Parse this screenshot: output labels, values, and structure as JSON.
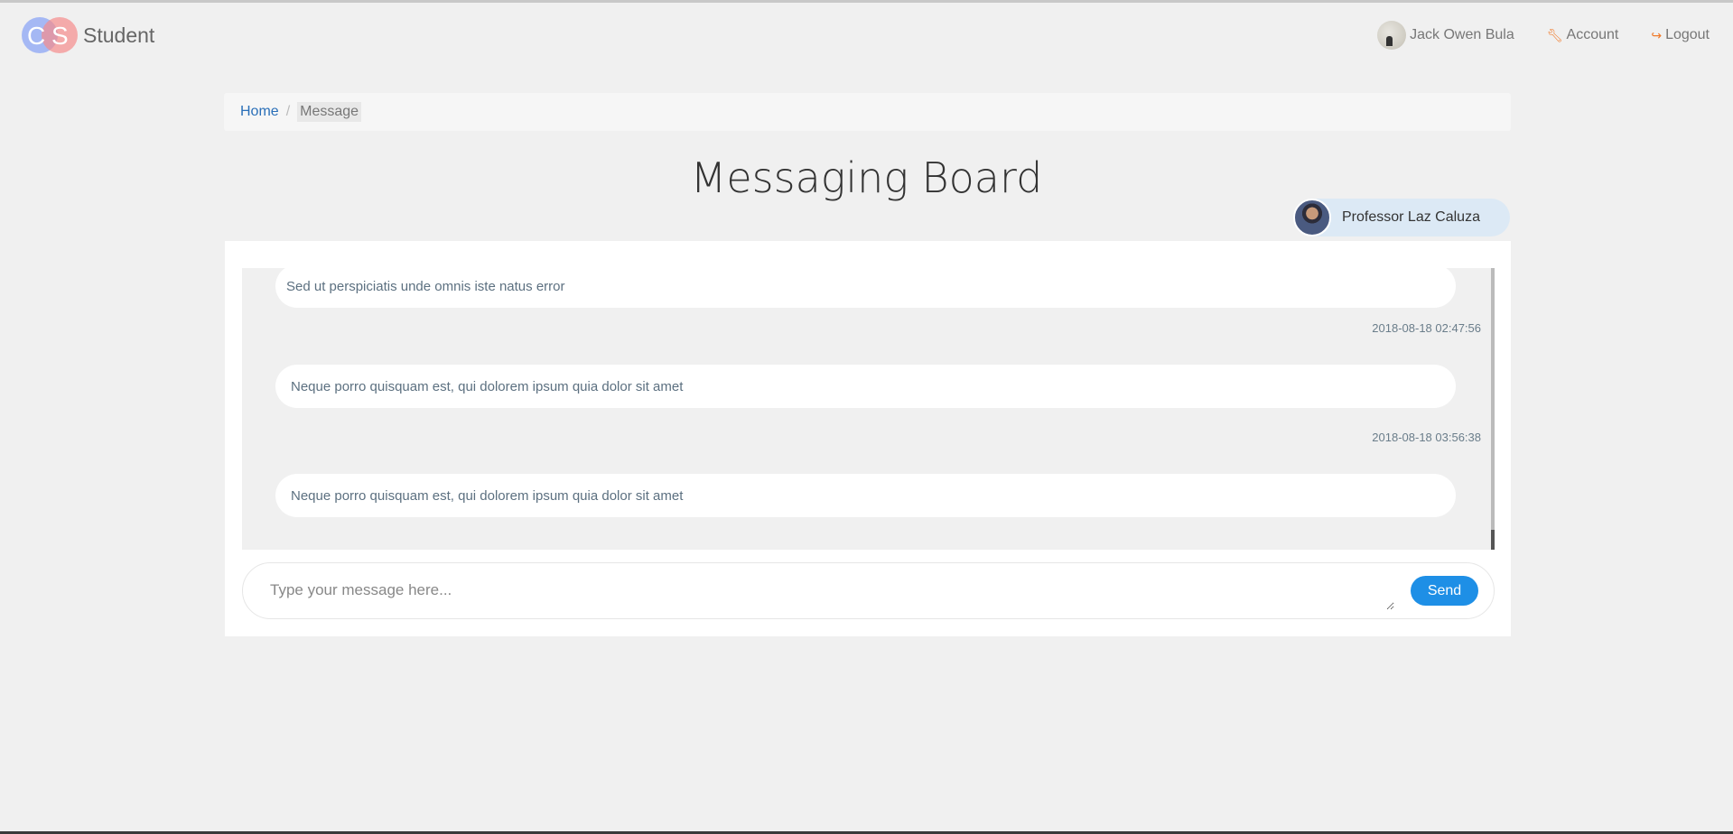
{
  "brand": {
    "name": "Student",
    "logo_letters": [
      "C",
      "S"
    ]
  },
  "nav": {
    "user_name": "Jack Owen Bula",
    "account_label": "Account",
    "logout_label": "Logout",
    "account_icon": "wrench-icon",
    "logout_icon": "sign-out-icon"
  },
  "breadcrumb": {
    "home": "Home",
    "separator": "/",
    "current": "Message"
  },
  "page": {
    "title": "Messaging Board"
  },
  "contact": {
    "name": "Professor Laz Caluza"
  },
  "messages": [
    {
      "text": "Sed ut perspiciatis unde omnis iste natus error",
      "timestamp": "2018-08-18 02:47:56"
    },
    {
      "text": "Neque porro quisquam est, qui dolorem ipsum quia dolor sit amet",
      "timestamp": "2018-08-18 03:56:38"
    },
    {
      "text": "Neque porro quisquam est, qui dolorem ipsum quia dolor sit amet",
      "timestamp": ""
    }
  ],
  "composer": {
    "placeholder": "Type your message here...",
    "send_label": "Send"
  },
  "colors": {
    "accent": "#1e8fe6",
    "link": "#2a6fb8",
    "icon_orange": "#f07a2a",
    "contact_bg": "#dce9f5"
  }
}
